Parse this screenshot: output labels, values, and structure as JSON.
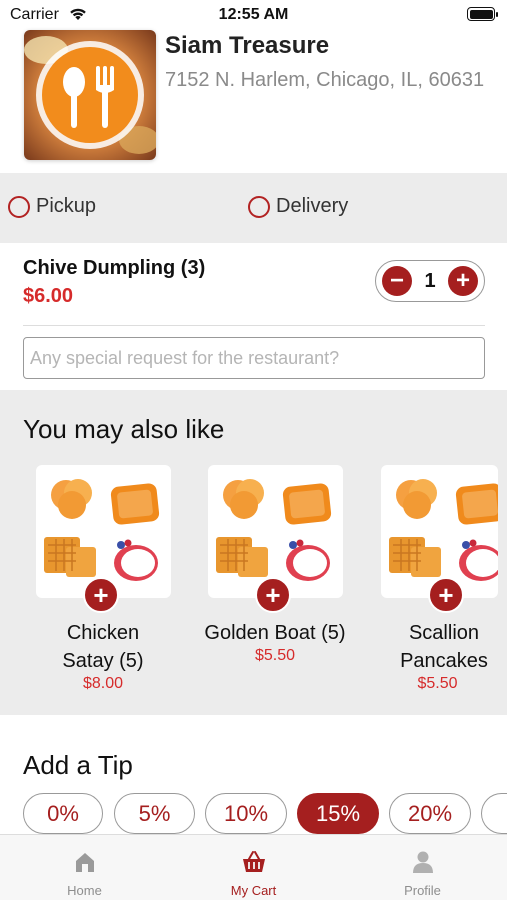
{
  "status_bar": {
    "carrier": "Carrier",
    "time": "12:55 AM"
  },
  "restaurant": {
    "name": "Siam Treasure",
    "address": "7152 N. Harlem, Chicago, IL, 60631"
  },
  "order_type": {
    "options": [
      {
        "label": "Pickup",
        "selected": false
      },
      {
        "label": "Delivery",
        "selected": false
      }
    ]
  },
  "cart_item": {
    "name": "Chive Dumpling (3)",
    "price": "$6.00",
    "quantity": "1",
    "decrement": "−",
    "increment": "+"
  },
  "special_request": {
    "placeholder": "Any special request for the restaurant?"
  },
  "suggestions": {
    "title": "You may also like",
    "add_label": "+",
    "items": [
      {
        "name": "Chicken Satay (5)",
        "price": "$8.00"
      },
      {
        "name": "Golden Boat (5)",
        "price": "$5.50"
      },
      {
        "name": "Scallion Pancakes",
        "price": "$5.50"
      }
    ]
  },
  "tip": {
    "title": "Add a Tip",
    "options": [
      "0%",
      "5%",
      "10%",
      "15%",
      "20%"
    ],
    "selected": "15%"
  },
  "tab_bar": {
    "tabs": [
      {
        "label": "Home",
        "icon": "home-icon"
      },
      {
        "label": "My Cart",
        "icon": "basket-icon"
      },
      {
        "label": "Profile",
        "icon": "person-icon"
      }
    ],
    "active": "My Cart"
  },
  "colors": {
    "accent": "#a51f1f",
    "price": "#d62b2b",
    "section_bg": "#ececec"
  }
}
